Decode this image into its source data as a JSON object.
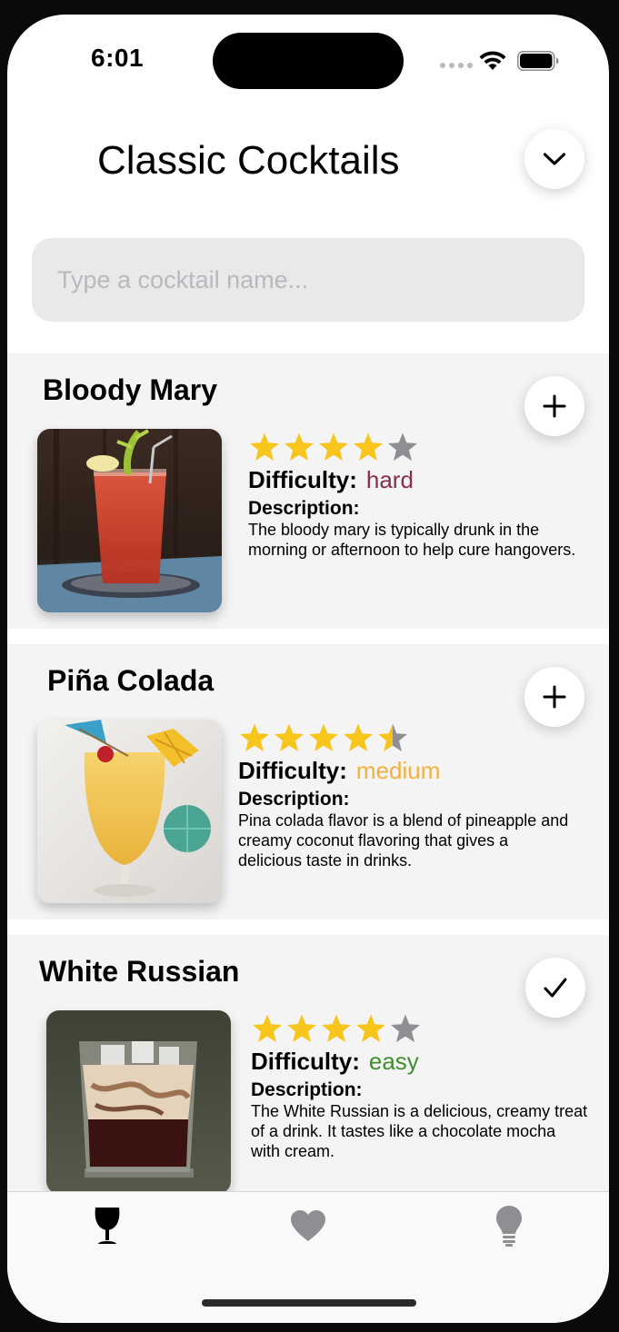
{
  "status": {
    "time": "6:01"
  },
  "header": {
    "title": "Classic Cocktails",
    "toggle_icon": "chevron-down-icon"
  },
  "search": {
    "placeholder": "Type a cocktail name...",
    "value": ""
  },
  "colors": {
    "star_filled": "#f7c51c",
    "star_empty": "#8e8e93",
    "hard": "#8b2d4d",
    "medium": "#f2b13d",
    "easy": "#3f8f2e"
  },
  "cocktails": [
    {
      "name": "Bloody Mary",
      "rating": 4,
      "difficulty_label": "Difficulty:",
      "difficulty": "hard",
      "description_label": "Description:",
      "description": "The bloody mary is typically drunk in the morning or afternoon to help cure hangovers.",
      "action_icon": "plus-icon"
    },
    {
      "name": "Piña Colada",
      "rating": 4.5,
      "difficulty_label": "Difficulty:",
      "difficulty": "medium",
      "description_label": "Description:",
      "description": "Pina colada flavor is a blend of pineapple and creamy coconut flavoring that gives a delicious taste in drinks.",
      "action_icon": "plus-icon"
    },
    {
      "name": "White Russian",
      "rating": 4,
      "difficulty_label": "Difficulty:",
      "difficulty": "easy",
      "description_label": "Description:",
      "description": "The White Russian is a delicious, creamy treat of a drink. It tastes like a chocolate mocha with cream.",
      "action_icon": "checkmark-icon"
    }
  ],
  "tabs": [
    {
      "icon": "wine-glass-icon",
      "selected": true
    },
    {
      "icon": "heart-icon",
      "selected": false
    },
    {
      "icon": "lightbulb-icon",
      "selected": false
    }
  ]
}
